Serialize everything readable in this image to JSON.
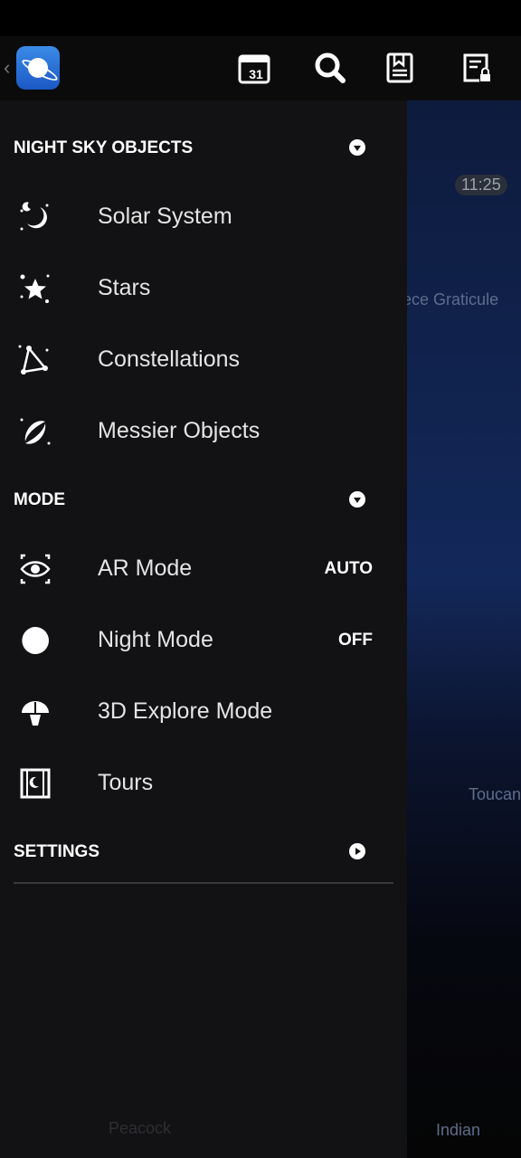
{
  "topbar": {
    "icons": [
      "back-chevron-icon",
      "app-logo",
      "calendar-icon",
      "search-icon",
      "bookmark-icon",
      "locked-document-icon"
    ],
    "calendar_day": "31"
  },
  "sky": {
    "clock": "11:25",
    "labels": [
      "Eyepiece Graticule",
      "Toucan",
      "Indian",
      "Peacock"
    ]
  },
  "sections": {
    "night_sky": {
      "title": "NIGHT SKY OBJECTS",
      "items": [
        {
          "label": "Solar System",
          "icon": "moon-icon"
        },
        {
          "label": "Stars",
          "icon": "star-icon"
        },
        {
          "label": "Constellations",
          "icon": "constellation-icon"
        },
        {
          "label": "Messier Objects",
          "icon": "galaxy-icon"
        }
      ]
    },
    "mode": {
      "title": "MODE",
      "items": [
        {
          "label": "AR Mode",
          "value": "AUTO",
          "icon": "eye-icon"
        },
        {
          "label": "Night Mode",
          "value": "OFF",
          "icon": "half-moon-icon"
        },
        {
          "label": "3D Explore Mode",
          "icon": "observatory-icon"
        },
        {
          "label": "Tours",
          "icon": "film-icon"
        }
      ]
    },
    "settings": {
      "title": "SETTINGS"
    }
  }
}
